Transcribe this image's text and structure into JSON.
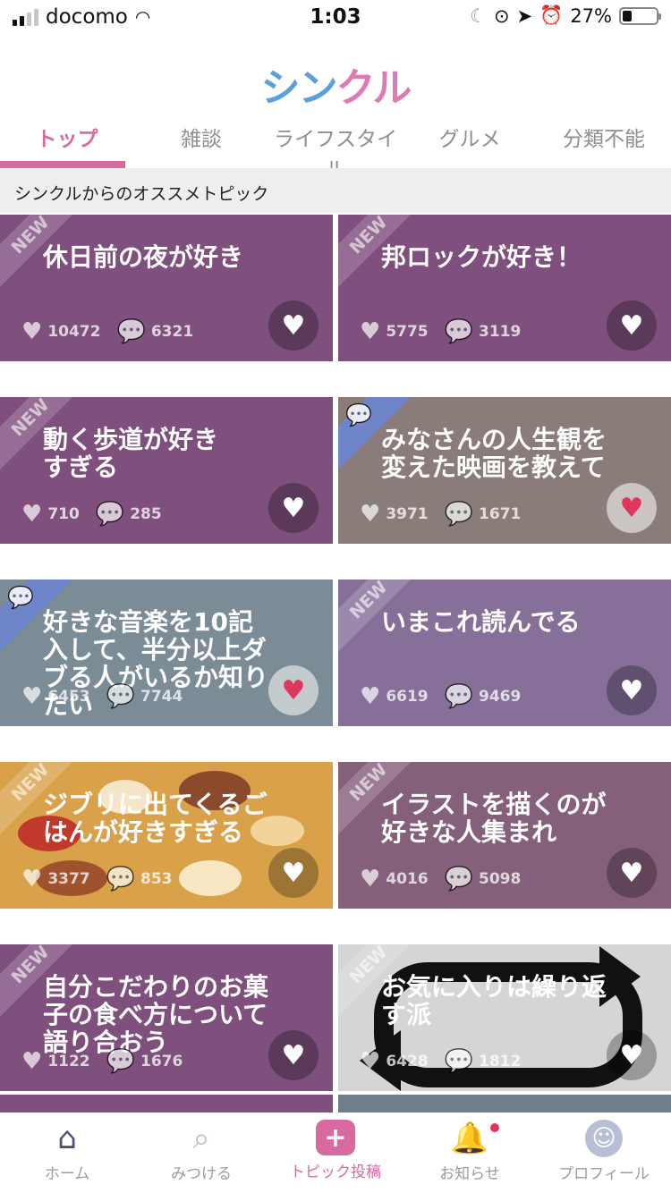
{
  "status_bar": {
    "carrier": "docomo",
    "time": "1:03",
    "battery": "27%",
    "battery_level": 0.27
  },
  "logo": {
    "part1": "シン",
    "part2": "クル"
  },
  "tabs": [
    {
      "label": "トップ"
    },
    {
      "label": "雑談"
    },
    {
      "label": "ライフスタイル"
    },
    {
      "label": "グルメ"
    },
    {
      "label": "分類不能"
    }
  ],
  "section_header": "シンクルからのオススメトピック",
  "cards": [
    {
      "title": "休日前の夜が好き",
      "likes": "10472",
      "comments": "6321",
      "ribbon": "NEW",
      "liked": false,
      "bg": "#7f4f7e"
    },
    {
      "title": "邦ロックが好き！",
      "likes": "5775",
      "comments": "3119",
      "ribbon": "NEW",
      "liked": false,
      "bg": "#7f4f7e"
    },
    {
      "title": "動く歩道が好き\nすぎる",
      "likes": "710",
      "comments": "285",
      "ribbon": "NEW",
      "liked": false,
      "bg": "#7f4f7e"
    },
    {
      "title": "みなさんの人生観を\n変えた映画を教えて",
      "likes": "3971",
      "comments": "1671",
      "ribbon": "",
      "liked": true,
      "bg": "#8a7c78"
    },
    {
      "title": "好きな音楽を10記\n入して、半分以上ダ\nブる人がいるか知り\nたい",
      "likes": "6453",
      "comments": "7744",
      "ribbon": "",
      "liked": true,
      "bg": "#7b8c96"
    },
    {
      "title": "いまこれ読んでる",
      "likes": "6619",
      "comments": "9469",
      "ribbon": "NEW",
      "liked": false,
      "bg": "#86709a"
    },
    {
      "title": "ジブリに出てくるご\nはんが好きすぎる",
      "likes": "3377",
      "comments": "853",
      "ribbon": "NEW",
      "liked": false,
      "bg": "#d9a24a"
    },
    {
      "title": "イラストを描くのが\n好きな人集まれ",
      "likes": "4016",
      "comments": "5098",
      "ribbon": "NEW",
      "liked": false,
      "bg": "#85607a"
    },
    {
      "title": "自分こだわりのお菓\n子の食べ方について\n語り合おう",
      "likes": "1122",
      "comments": "1676",
      "ribbon": "NEW",
      "liked": false,
      "bg": "#7f4f7e"
    },
    {
      "title": "お気に入りは繰り返\nす派",
      "likes": "6428",
      "comments": "1812",
      "ribbon": "NEW",
      "liked": false,
      "bg": "#d5d5d5"
    }
  ],
  "bottom_nav": [
    {
      "label": "ホーム",
      "icon": "home-icon"
    },
    {
      "label": "みつける",
      "icon": "search-icon"
    },
    {
      "label": "トピック投稿",
      "icon": "plus-icon"
    },
    {
      "label": "お知らせ",
      "icon": "bell-icon"
    },
    {
      "label": "プロフィール",
      "icon": "profile-icon"
    }
  ],
  "colors": {
    "accent": "#d76b9f",
    "liked_heart": "#e0365b"
  }
}
